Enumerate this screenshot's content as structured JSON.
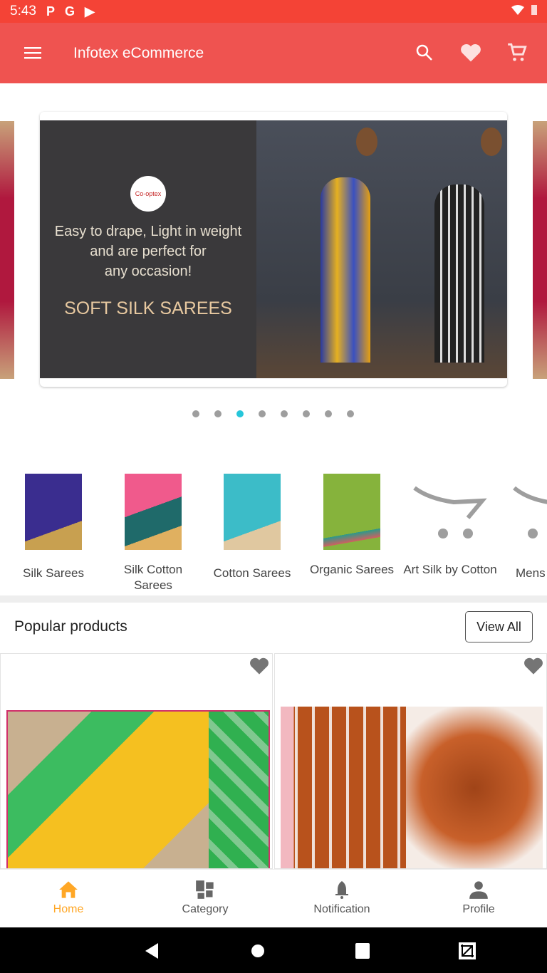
{
  "status_bar": {
    "time": "5:43",
    "notification_icons": [
      "P",
      "G",
      "▶"
    ]
  },
  "app_bar": {
    "title": "Infotex eCommerce",
    "icons": [
      "menu-icon",
      "search-icon",
      "heart-icon",
      "cart-icon"
    ]
  },
  "banner": {
    "line1": "Easy to drape, Light in weight",
    "line2": "and are perfect for",
    "line3": "any occasion!",
    "headline": "SOFT SILK SAREES",
    "logo_text": "Co-optex",
    "slide_count": 8,
    "active_slide": 3
  },
  "categories": [
    {
      "label": "Silk Sarees",
      "color": "#3a2d8f"
    },
    {
      "label": "Silk Cotton Sarees",
      "color": "#f05a8c"
    },
    {
      "label": "Cotton Sarees",
      "color": "#3cbcc8"
    },
    {
      "label": "Organic Sarees",
      "color": "#86b33c"
    },
    {
      "label": "Art Silk by Cotton",
      "color": ""
    },
    {
      "label": "Mens",
      "color": ""
    }
  ],
  "popular": {
    "title": "Popular products",
    "view_all": "View All"
  },
  "bottom_nav": [
    {
      "label": "Home",
      "active": true
    },
    {
      "label": "Category"
    },
    {
      "label": "Notification"
    },
    {
      "label": "Profile"
    }
  ],
  "colors": {
    "status": "#f44336",
    "appbar": "#ef5350",
    "active_nav": "#ffa726",
    "indicator": "#26c6da"
  }
}
